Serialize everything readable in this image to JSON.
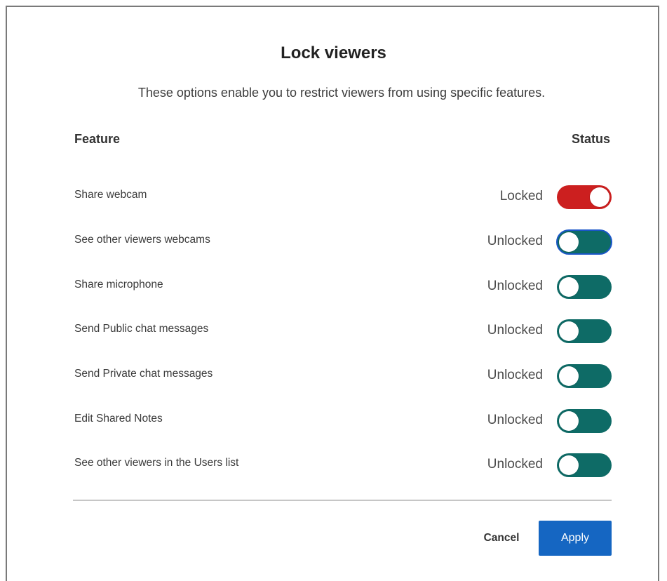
{
  "dialog": {
    "title": "Lock viewers",
    "subtitle": "These options enable you to restrict viewers from using specific features."
  },
  "table": {
    "headers": {
      "feature": "Feature",
      "status": "Status"
    },
    "rows": [
      {
        "label": "Share webcam",
        "status": "Locked",
        "locked": true,
        "focused": false
      },
      {
        "label": "See other viewers webcams",
        "status": "Unlocked",
        "locked": false,
        "focused": true
      },
      {
        "label": "Share microphone",
        "status": "Unlocked",
        "locked": false,
        "focused": false
      },
      {
        "label": "Send Public chat messages",
        "status": "Unlocked",
        "locked": false,
        "focused": false
      },
      {
        "label": "Send Private chat messages",
        "status": "Unlocked",
        "locked": false,
        "focused": false
      },
      {
        "label": "Edit Shared Notes",
        "status": "Unlocked",
        "locked": false,
        "focused": false
      },
      {
        "label": "See other viewers in the Users list",
        "status": "Unlocked",
        "locked": false,
        "focused": false
      }
    ]
  },
  "footer": {
    "cancel_label": "Cancel",
    "apply_label": "Apply"
  },
  "colors": {
    "locked": "#cc1f1f",
    "unlocked": "#0e6b66",
    "primary": "#1566c2",
    "focus": "#1a56c8"
  }
}
